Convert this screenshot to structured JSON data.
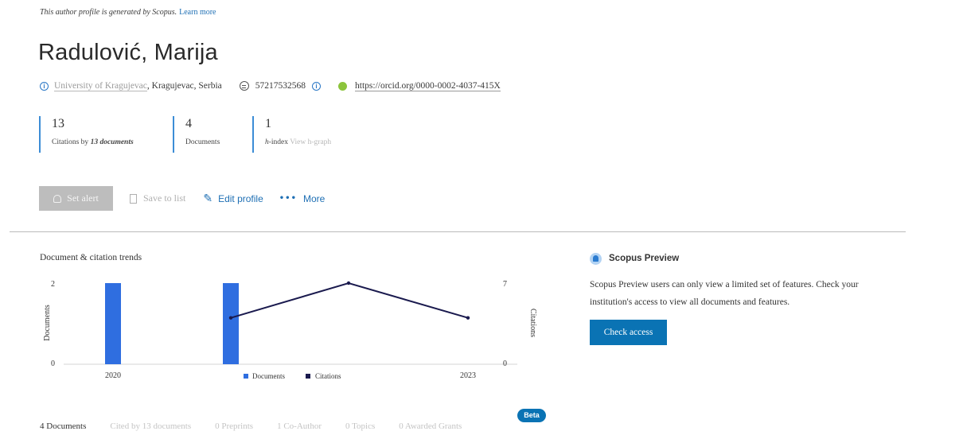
{
  "notice": {
    "text": "This author profile is generated by Scopus.",
    "link": "Learn more"
  },
  "author": {
    "name": "Radulović, Marija",
    "affiliation_link": "University of Kragujevac",
    "affiliation_rest": ", Kragujevac, Serbia",
    "scopus_id": "57217532568",
    "orcid": "https://orcid.org/0000-0002-4037-415X"
  },
  "metrics": [
    {
      "value": "13",
      "label": "Citations by",
      "label_em": "13 documents",
      "label_muted": ""
    },
    {
      "value": "4",
      "label": "Documents",
      "label_em": "",
      "label_muted": ""
    },
    {
      "value": "1",
      "label": "",
      "label_em": "h",
      "label_after": "-index",
      "label_muted": "View h-graph"
    }
  ],
  "actions": {
    "set_alert": "Set alert",
    "save_to_list": "Save to list",
    "edit_profile": "Edit profile",
    "more": "More"
  },
  "chart_section": {
    "title": "Document & citation trends"
  },
  "chart_data": {
    "type": "bar+line",
    "title": "Document & citation trends",
    "x_tick_labels": [
      "2020",
      "2023"
    ],
    "years": [
      2020,
      2021,
      2022,
      2023
    ],
    "series": [
      {
        "name": "Documents",
        "type": "bar",
        "axis": "left",
        "color": "#2f6ee0",
        "values": [
          2,
          2,
          0,
          0
        ]
      },
      {
        "name": "Citations",
        "type": "line",
        "axis": "right",
        "color": "#1a1a4e",
        "values": [
          null,
          4,
          7,
          4
        ]
      }
    ],
    "left_axis": {
      "label": "Documents",
      "range": [
        0,
        2
      ],
      "ticks": [
        "0",
        "2"
      ]
    },
    "right_axis": {
      "label": "Citations",
      "range": [
        0,
        7
      ],
      "ticks": [
        "0",
        "7"
      ]
    },
    "legend_placement": "bottom",
    "grid": false
  },
  "preview_panel": {
    "title": "Scopus Preview",
    "body": "Scopus Preview users can only view a limited set of features. Check your institution's access to view all documents and features.",
    "button": "Check access"
  },
  "tabs": [
    {
      "label": "4 Documents",
      "active": true
    },
    {
      "label": "Cited by 13 documents",
      "active": false
    },
    {
      "label": "0 Preprints",
      "active": false
    },
    {
      "label": "1 Co-Author",
      "active": false
    },
    {
      "label": "0 Topics",
      "active": false
    },
    {
      "label": "0 Awarded Grants",
      "active": false
    }
  ],
  "badge": "Beta"
}
